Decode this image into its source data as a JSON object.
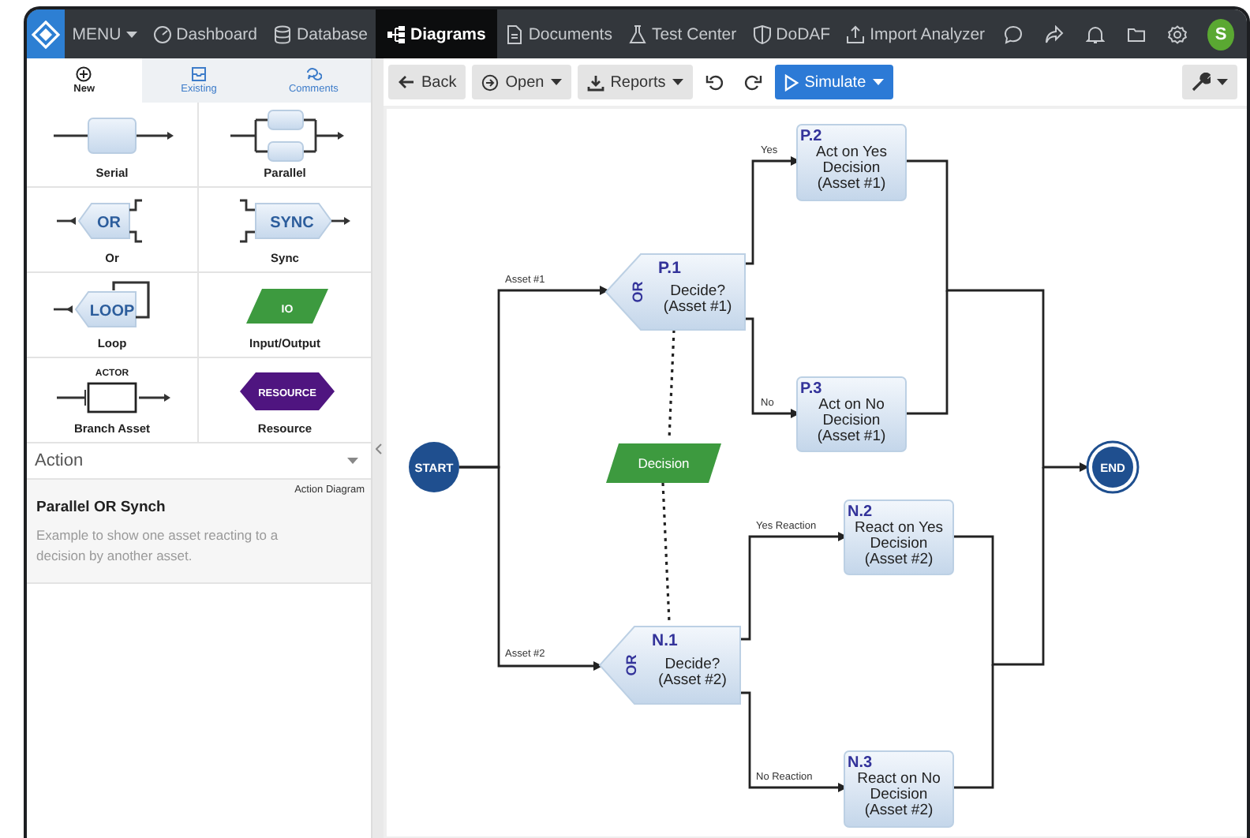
{
  "nav": {
    "menu": "MENU",
    "items": [
      {
        "label": "Dashboard",
        "selected": false
      },
      {
        "label": "Database",
        "selected": false
      },
      {
        "label": "Diagrams",
        "selected": true
      },
      {
        "label": "Documents",
        "selected": false
      },
      {
        "label": "Test Center",
        "selected": false
      },
      {
        "label": "DoDAF",
        "selected": false
      },
      {
        "label": "Import Analyzer",
        "selected": false
      }
    ],
    "avatar": "S"
  },
  "side_tabs": [
    {
      "label": "New",
      "selected": true
    },
    {
      "label": "Existing",
      "selected": false
    },
    {
      "label": "Comments",
      "selected": false
    }
  ],
  "palette": [
    {
      "kind": "serial",
      "label": "Serial"
    },
    {
      "kind": "parallel",
      "label": "Parallel"
    },
    {
      "kind": "or",
      "label": "Or",
      "shape_text": "OR"
    },
    {
      "kind": "sync",
      "label": "Sync",
      "shape_text": "SYNC"
    },
    {
      "kind": "loop",
      "label": "Loop",
      "shape_text": "LOOP"
    },
    {
      "kind": "io",
      "label": "Input/Output",
      "shape_text": "IO"
    },
    {
      "kind": "actor",
      "label": "Branch Asset",
      "shape_text": "ACTOR"
    },
    {
      "kind": "resource",
      "label": "Resource",
      "shape_text": "RESOURCE"
    }
  ],
  "category_select": {
    "value": "Action"
  },
  "example": {
    "type": "Action Diagram",
    "title": "Parallel OR Synch",
    "description": "Example to show one asset reacting to a decision by another asset."
  },
  "toolbar": {
    "back": "Back",
    "open": "Open",
    "reports": "Reports",
    "simulate": "Simulate"
  },
  "diagram": {
    "nodes": [
      {
        "kind": "start",
        "label": "START"
      },
      {
        "kind": "or",
        "id": "P.1",
        "gate": "OR",
        "lines": [
          "Decide?",
          "(Asset #1)"
        ]
      },
      {
        "kind": "task",
        "id": "P.2",
        "lines": [
          "Act on Yes",
          "Decision",
          "(Asset #1)"
        ]
      },
      {
        "kind": "task",
        "id": "P.3",
        "lines": [
          "Act on No",
          "Decision",
          "(Asset #1)"
        ]
      },
      {
        "kind": "io",
        "label": "Decision"
      },
      {
        "kind": "or",
        "id": "N.1",
        "gate": "OR",
        "lines": [
          "Decide?",
          "(Asset #2)"
        ]
      },
      {
        "kind": "task",
        "id": "N.2",
        "lines": [
          "React on Yes",
          "Decision",
          "(Asset #2)"
        ]
      },
      {
        "kind": "task",
        "id": "N.3",
        "lines": [
          "React on No",
          "Decision",
          "(Asset #2)"
        ]
      },
      {
        "kind": "end",
        "label": "END"
      }
    ],
    "edges": [
      {
        "kind": "flow",
        "label": "Asset #1"
      },
      {
        "kind": "flow",
        "label": "Asset #2"
      },
      {
        "kind": "flow",
        "label": "Yes"
      },
      {
        "kind": "flow",
        "label": "No"
      },
      {
        "kind": "flow"
      },
      {
        "kind": "flow"
      },
      {
        "kind": "flow",
        "label": "Yes Reaction"
      },
      {
        "kind": "flow",
        "label": "No Reaction"
      },
      {
        "kind": "flow"
      },
      {
        "kind": "flow"
      },
      {
        "kind": "dependency"
      },
      {
        "kind": "dependency"
      }
    ]
  }
}
